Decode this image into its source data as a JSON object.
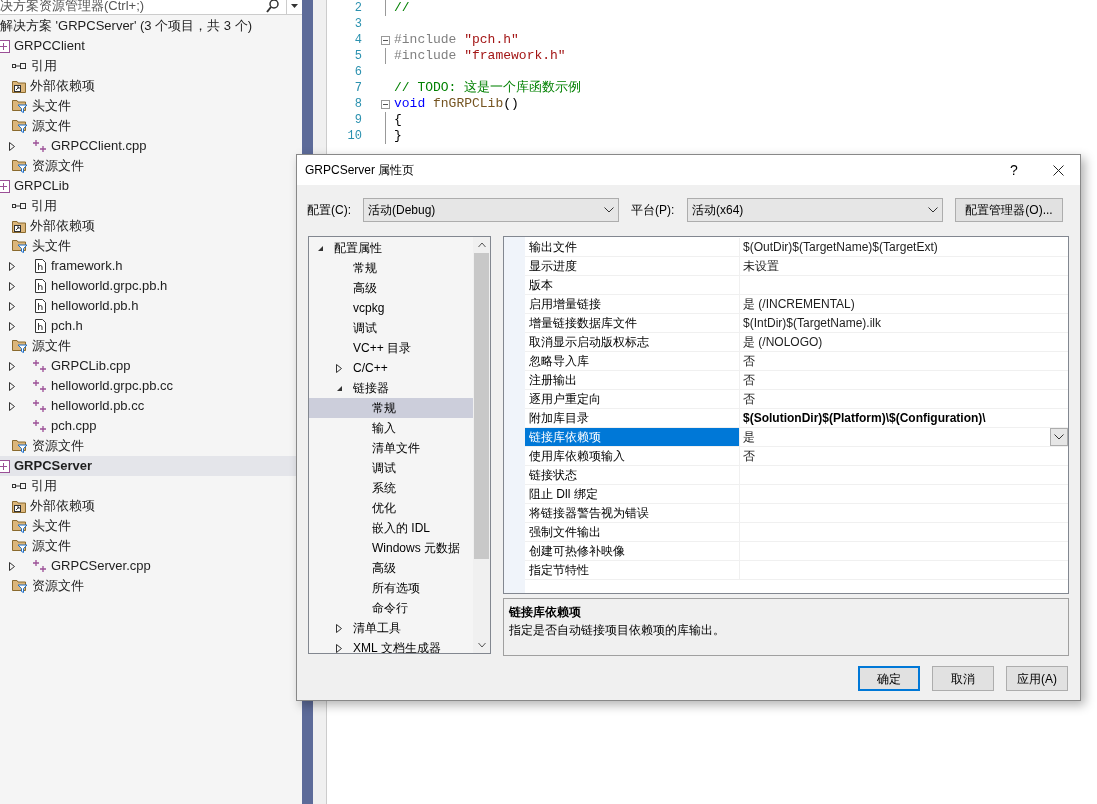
{
  "explorer": {
    "search": {
      "placeholder": "决方案资源管理器(Ctrl+;)"
    },
    "solution": "解决方案 'GRPCServer' (3 个项目，共 3 个)",
    "projects": [
      {
        "label": "GRPCClient",
        "selected": false,
        "startup": false,
        "children": [
          {
            "label": "引用",
            "kind": "reference"
          },
          {
            "label": "外部依赖项",
            "kind": "external"
          },
          {
            "label": "头文件",
            "kind": "filter"
          },
          {
            "label": "源文件",
            "kind": "filter",
            "children": [
              {
                "label": "GRPCClient.cpp",
                "kind": "cpp",
                "expanded": false
              }
            ]
          },
          {
            "label": "资源文件",
            "kind": "filter"
          }
        ]
      },
      {
        "label": "GRPCLib",
        "selected": false,
        "startup": false,
        "children": [
          {
            "label": "引用",
            "kind": "reference"
          },
          {
            "label": "外部依赖项",
            "kind": "external"
          },
          {
            "label": "头文件",
            "kind": "filter",
            "children": [
              {
                "label": "framework.h",
                "kind": "header",
                "expanded": false
              },
              {
                "label": "helloworld.grpc.pb.h",
                "kind": "header",
                "expanded": false
              },
              {
                "label": "helloworld.pb.h",
                "kind": "header",
                "expanded": false
              },
              {
                "label": "pch.h",
                "kind": "header",
                "expanded": false
              }
            ]
          },
          {
            "label": "源文件",
            "kind": "filter",
            "children": [
              {
                "label": "GRPCLib.cpp",
                "kind": "cpp",
                "expanded": false
              },
              {
                "label": "helloworld.grpc.pb.cc",
                "kind": "cpp",
                "expanded": false
              },
              {
                "label": "helloworld.pb.cc",
                "kind": "cpp",
                "expanded": false
              },
              {
                "label": "pch.cpp",
                "kind": "cpp"
              }
            ]
          },
          {
            "label": "资源文件",
            "kind": "filter"
          }
        ]
      },
      {
        "label": "GRPCServer",
        "selected": true,
        "startup": true,
        "children": [
          {
            "label": "引用",
            "kind": "reference"
          },
          {
            "label": "外部依赖项",
            "kind": "external"
          },
          {
            "label": "头文件",
            "kind": "filter"
          },
          {
            "label": "源文件",
            "kind": "filter",
            "children": [
              {
                "label": "GRPCServer.cpp",
                "kind": "cpp",
                "expanded": false
              }
            ]
          },
          {
            "label": "资源文件",
            "kind": "filter"
          }
        ]
      }
    ]
  },
  "editor": {
    "lines": [
      {
        "number": "2",
        "collapsible": false,
        "in_block": true,
        "tokens": [
          {
            "kind": "comment",
            "text": "//"
          }
        ]
      },
      {
        "number": "3",
        "collapsible": false,
        "in_block": false
      },
      {
        "number": "4",
        "collapsible": true,
        "in_block": false,
        "tokens": [
          {
            "kind": "preprocessor",
            "text": "#include "
          },
          {
            "kind": "string",
            "text": "\"pch.h\""
          }
        ]
      },
      {
        "number": "5",
        "collapsible": false,
        "in_block": true,
        "tokens": [
          {
            "kind": "preprocessor",
            "text": "#include "
          },
          {
            "kind": "string",
            "text": "\"framework.h\""
          }
        ]
      },
      {
        "number": "6",
        "collapsible": false,
        "in_block": false
      },
      {
        "number": "7",
        "collapsible": false,
        "in_block": false,
        "tokens": [
          {
            "kind": "comment",
            "text": "// TODO: 这是一个库函数示例"
          }
        ]
      },
      {
        "number": "8",
        "collapsible": true,
        "in_block": false,
        "tokens": [
          {
            "kind": "keyword",
            "text": "void "
          },
          {
            "kind": "function",
            "text": "fnGRPCLib"
          },
          {
            "kind": "plain",
            "text": "()"
          }
        ]
      },
      {
        "number": "9",
        "collapsible": false,
        "in_block": true,
        "tokens": [
          {
            "kind": "plain",
            "text": "{"
          }
        ]
      },
      {
        "number": "10",
        "collapsible": false,
        "in_block": true,
        "tokens": [
          {
            "kind": "plain",
            "text": "}"
          }
        ]
      }
    ]
  },
  "dialog": {
    "title": "GRPCServer 属性页",
    "help": "?",
    "config_label": "配置(C):",
    "config_value": "活动(Debug)",
    "platform_label": "平台(P):",
    "platform_value": "活动(x64)",
    "manager_button": "配置管理器(O)...",
    "tree": [
      {
        "label": "配置属性",
        "selected": false,
        "expanded": true,
        "children": [
          {
            "label": "常规",
            "selected": false
          },
          {
            "label": "高级",
            "selected": false
          },
          {
            "label": "vcpkg",
            "selected": false
          },
          {
            "label": "调试",
            "selected": false
          },
          {
            "label": "VC++ 目录",
            "selected": false
          },
          {
            "label": "C/C++",
            "selected": false,
            "expanded": false
          },
          {
            "label": "链接器",
            "selected": false,
            "expanded": true,
            "children": [
              {
                "label": "常规",
                "selected": true
              },
              {
                "label": "输入",
                "selected": false
              },
              {
                "label": "清单文件",
                "selected": false
              },
              {
                "label": "调试",
                "selected": false
              },
              {
                "label": "系统",
                "selected": false
              },
              {
                "label": "优化",
                "selected": false
              },
              {
                "label": "嵌入的 IDL",
                "selected": false
              },
              {
                "label": "Windows 元数据",
                "selected": false
              },
              {
                "label": "高级",
                "selected": false
              },
              {
                "label": "所有选项",
                "selected": false
              },
              {
                "label": "命令行",
                "selected": false
              }
            ]
          },
          {
            "label": "清单工具",
            "selected": false,
            "expanded": false
          },
          {
            "label": "XML 文档生成器",
            "selected": false,
            "expanded": false
          }
        ]
      }
    ],
    "properties": [
      {
        "name": "输出文件",
        "value": "$(OutDir)$(TargetName)$(TargetExt)",
        "selected": false,
        "modified": false
      },
      {
        "name": "显示进度",
        "value": "未设置",
        "selected": false,
        "modified": false
      },
      {
        "name": "版本",
        "selected": false
      },
      {
        "name": "启用增量链接",
        "value": "是 (/INCREMENTAL)",
        "selected": false,
        "modified": false
      },
      {
        "name": "增量链接数据库文件",
        "value": "$(IntDir)$(TargetName).ilk",
        "selected": false,
        "modified": false
      },
      {
        "name": "取消显示启动版权标志",
        "value": "是 (/NOLOGO)",
        "selected": false,
        "modified": false
      },
      {
        "name": "忽略导入库",
        "value": "否",
        "selected": false,
        "modified": false
      },
      {
        "name": "注册输出",
        "value": "否",
        "selected": false,
        "modified": false
      },
      {
        "name": "逐用户重定向",
        "value": "否",
        "selected": false,
        "modified": false
      },
      {
        "name": "附加库目录",
        "value": "$(SolutionDir)$(Platform)\\$(Configuration)\\",
        "selected": false,
        "modified": true
      },
      {
        "name": "链接库依赖项",
        "value": "是",
        "selected": true,
        "modified": false
      },
      {
        "name": "使用库依赖项输入",
        "value": "否",
        "selected": false,
        "modified": false
      },
      {
        "name": "链接状态",
        "selected": false
      },
      {
        "name": "阻止 Dll 绑定",
        "selected": false
      },
      {
        "name": "将链接器警告视为错误",
        "selected": false
      },
      {
        "name": "强制文件输出",
        "selected": false
      },
      {
        "name": "创建可热修补映像",
        "selected": false
      },
      {
        "name": "指定节特性",
        "selected": false
      }
    ],
    "description": {
      "title": "链接库依赖项",
      "text": "指定是否自动链接项目依赖项的库输出。"
    },
    "buttons": [
      {
        "label": "确定",
        "default": true
      },
      {
        "label": "取消",
        "default": false
      },
      {
        "label": "应用(A)",
        "default": false
      }
    ]
  }
}
